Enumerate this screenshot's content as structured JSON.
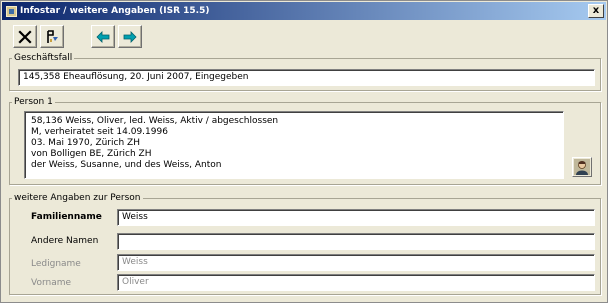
{
  "window": {
    "title": "Infostar / weitere Angaben (ISR 15.5)",
    "close_label": "x"
  },
  "toolbar": {
    "buttons": [
      {
        "name": "cancel-button",
        "icon": "x-icon"
      },
      {
        "name": "save-button",
        "icon": "save-icon"
      },
      {
        "name": "back-button",
        "icon": "arrow-left-icon"
      },
      {
        "name": "forward-button",
        "icon": "arrow-right-icon"
      }
    ]
  },
  "geschaeftsfall": {
    "legend": "Geschäftsfall",
    "value": "145,358  Eheauflösung, 20. Juni 2007, Eingegeben"
  },
  "person": {
    "legend": "Person 1",
    "lines": [
      "58,136  Weiss, Oliver, led. Weiss, Aktiv / abgeschlossen",
      "M, verheiratet seit 14.09.1996",
      "03. Mai 1970, Zürich ZH",
      "von Bolligen BE, Zürich ZH",
      "der Weiss, Susanne, und des Weiss, Anton"
    ]
  },
  "weitere": {
    "legend": "weitere Angaben zur Person",
    "fields": [
      {
        "label": "Familienname",
        "value": "Weiss"
      },
      {
        "label": "Andere Namen",
        "value": ""
      },
      {
        "label": "Ledigname",
        "value": "Weiss"
      },
      {
        "label": "Vorname",
        "value": "Oliver"
      }
    ]
  }
}
